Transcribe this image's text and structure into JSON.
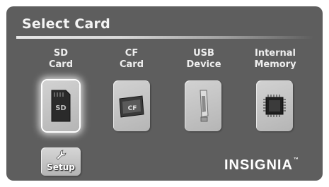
{
  "screen": {
    "title": "Select Card"
  },
  "cards": [
    {
      "id": "sd",
      "line1": "SD",
      "line2": "Card",
      "icon": "sd-card-icon",
      "icon_text": "SD",
      "selected": true
    },
    {
      "id": "cf",
      "line1": "CF",
      "line2": "Card",
      "icon": "cf-card-icon",
      "icon_text": "CF",
      "selected": false
    },
    {
      "id": "usb",
      "line1": "USB",
      "line2": "Device",
      "icon": "usb-drive-icon",
      "selected": false
    },
    {
      "id": "internal",
      "line1": "Internal",
      "line2": "Memory",
      "icon": "memory-chip-icon",
      "selected": false
    }
  ],
  "setup": {
    "label": "Setup",
    "icon": "wrench-icon"
  },
  "brand": {
    "name": "INSIGNIA",
    "mark": "™"
  },
  "colors": {
    "background": "#5e5e5e",
    "tile": "#c4c4c4",
    "text": "#f0f0f0"
  }
}
